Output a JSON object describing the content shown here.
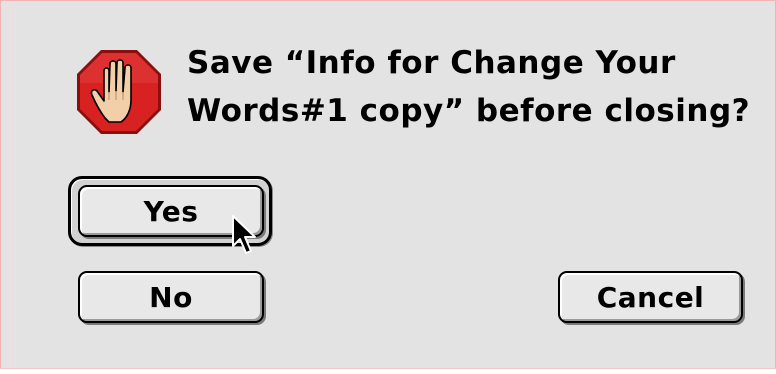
{
  "dialog": {
    "message_line1": "Save “Info for Change Your",
    "message_line2": "Words#1 copy” before closing?",
    "icon": "stop-hand-icon"
  },
  "buttons": {
    "yes_label": "Yes",
    "no_label": "No",
    "cancel_label": "Cancel",
    "default": "Yes"
  },
  "colors": {
    "dialog_background": "#e3e3e3",
    "stop_sign_red": "#d82222",
    "hand_skin": "#f2cfa8"
  },
  "cursor": {
    "icon": "arrow-pointer-icon"
  }
}
